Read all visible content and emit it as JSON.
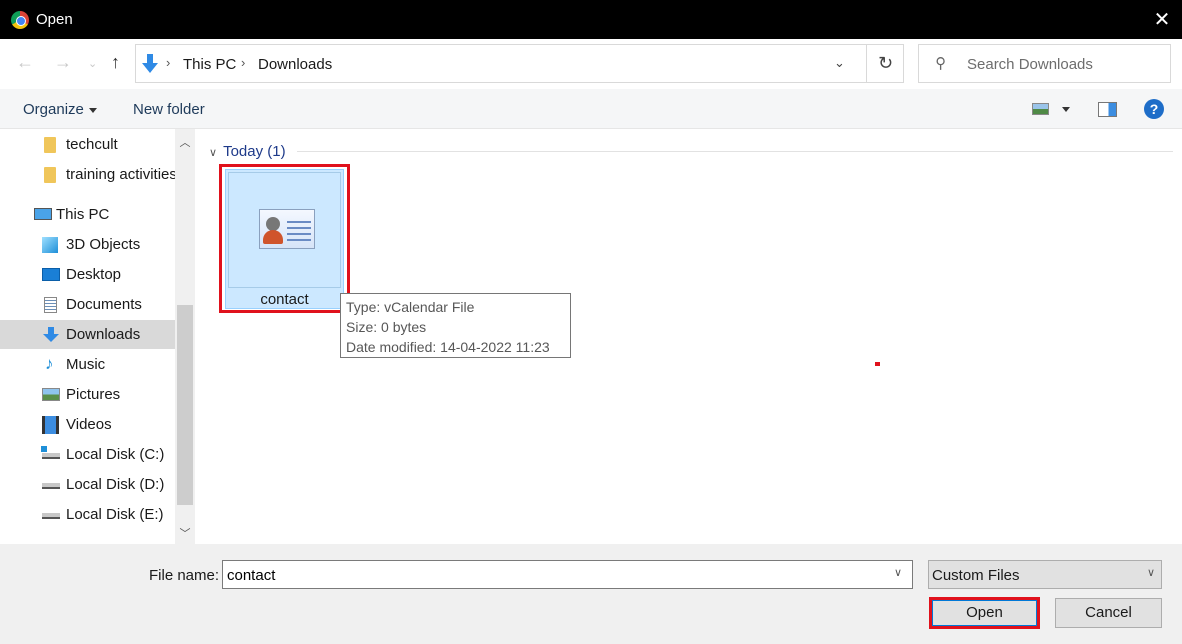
{
  "window": {
    "title": "Open",
    "app_icon": "chrome-icon",
    "close_icon": "close-icon"
  },
  "navigation": {
    "back_icon": "arrow-left-icon",
    "forward_icon": "arrow-right-icon",
    "recent_icon": "chevron-down-icon",
    "up_icon": "arrow-up-icon",
    "breadcrumb": [
      {
        "label": "This PC"
      },
      {
        "label": "Downloads"
      }
    ],
    "refresh_icon": "refresh-icon",
    "search_placeholder": "Search Downloads"
  },
  "toolbar": {
    "organize_label": "Organize",
    "new_folder_label": "New folder",
    "view_icon": "change-view-icon",
    "preview_pane_icon": "preview-pane-icon",
    "help_icon": "help-icon"
  },
  "sidebar": {
    "items": [
      {
        "label": "techcult",
        "icon": "folder-icon"
      },
      {
        "label": "training activities",
        "icon": "folder-icon"
      },
      {
        "label": "This PC",
        "icon": "computer-icon"
      },
      {
        "label": "3D Objects",
        "icon": "3d-objects-icon"
      },
      {
        "label": "Desktop",
        "icon": "desktop-icon"
      },
      {
        "label": "Documents",
        "icon": "documents-icon"
      },
      {
        "label": "Downloads",
        "icon": "downloads-icon",
        "selected": true
      },
      {
        "label": "Music",
        "icon": "music-icon"
      },
      {
        "label": "Pictures",
        "icon": "pictures-icon"
      },
      {
        "label": "Videos",
        "icon": "videos-icon"
      },
      {
        "label": "Local Disk (C:)",
        "icon": "drive-c-icon"
      },
      {
        "label": "Local Disk (D:)",
        "icon": "drive-icon"
      },
      {
        "label": "Local Disk (E:)",
        "icon": "drive-icon"
      }
    ]
  },
  "content": {
    "group_header": "Today (1)",
    "files": [
      {
        "name": "contact",
        "icon": "contact-card-icon",
        "selected": true
      }
    ],
    "tooltip": {
      "type": "Type: vCalendar File",
      "size": "Size: 0 bytes",
      "date": "Date modified: 14-04-2022 11:23"
    }
  },
  "footer": {
    "file_name_label": "File name:",
    "file_name_value": "contact",
    "file_type_value": "Custom Files",
    "open_label": "Open",
    "cancel_label": "Cancel"
  },
  "colors": {
    "highlight": "#e0111c",
    "selection": "#cce8ff",
    "accent": "#0078d7"
  }
}
